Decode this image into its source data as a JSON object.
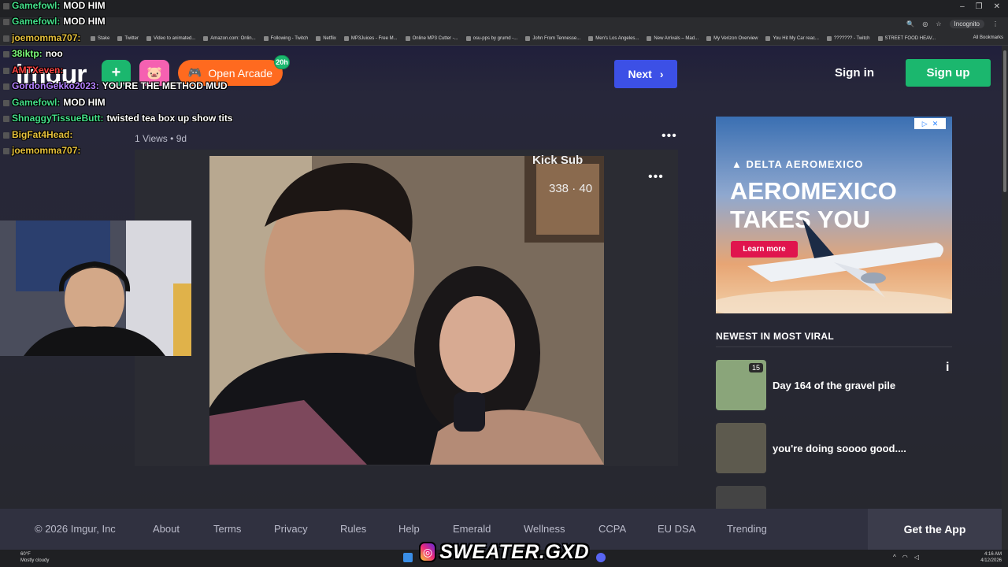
{
  "browser": {
    "window_controls": [
      "–",
      "❐",
      "✕"
    ],
    "incognito_label": "Incognito",
    "all_bookmarks": "All Bookmarks",
    "bookmarks": [
      "Stake",
      "Twitter",
      "Video to animated...",
      "Amazon.com: Onlin...",
      "Following - Twitch",
      "Netflix",
      "MP3Juices - Free M...",
      "Online MP3 Cutter -...",
      "osu-pps by grumd -...",
      "John From Tennesse...",
      "Men's Los Angeles...",
      "New Arrivals – Mad...",
      "My Verizon Overview",
      "You Hit My Car reac...",
      "??????? - Twitch",
      "STREET FOOD HEAV..."
    ]
  },
  "header": {
    "logo": "imgur",
    "new_post_icon": "+",
    "arcade_label": "Open Arcade",
    "arcade_badge": "20h",
    "next_label": "Next",
    "sign_in": "Sign in",
    "sign_up": "Sign up"
  },
  "post": {
    "views": "1 Views",
    "separator": "•",
    "age": "9d",
    "more": "•••",
    "overlay_title": "Kick Sub",
    "overlay_count": "338 · 40"
  },
  "ad": {
    "brand_line": "▲ DELTA   AEROMEXICO",
    "headline": "AEROMEXICO TAKES YOU",
    "cta": "Learn more"
  },
  "sidebar": {
    "section_title": "NEWEST IN MOST VIRAL",
    "items": [
      {
        "title": "Day 164 of the gravel pile",
        "count": "15",
        "thumb_color": "#8aa57a"
      },
      {
        "title": "you're doing soooo good....",
        "count": "",
        "thumb_color": "#5d5a4e"
      },
      {
        "title": "",
        "count": "",
        "thumb_color": "#444"
      }
    ]
  },
  "footer": {
    "copyright": "© 2026 Imgur, Inc",
    "links": [
      "About",
      "Terms",
      "Privacy",
      "Rules",
      "Help",
      "Emerald",
      "Wellness",
      "CCPA",
      "EU DSA",
      "Trending"
    ],
    "get_app": "Get the App"
  },
  "taskbar": {
    "temp": "60°F",
    "weather": "Mostly cloudy",
    "time": "4:16 AM",
    "date": "4/12/2026"
  },
  "chat": [
    {
      "user": "Gamefowl:",
      "msg": "MOD HIM",
      "color": "#44e08a"
    },
    {
      "user": "Gamefowl:",
      "msg": "MOD HIM",
      "color": "#44e08a"
    },
    {
      "user": "joemomma707:",
      "msg": "",
      "color": "#e6c13c"
    },
    {
      "user": "38iktp:",
      "msg": "noo",
      "color": "#7cfc7c"
    },
    {
      "user": "AMTXeven:",
      "msg": "",
      "color": "#ff4444"
    },
    {
      "user": "GordonGekko2023:",
      "msg": "YOU'RE THE METHOD MUD",
      "color": "#b380ff"
    },
    {
      "user": "Gamefowl:",
      "msg": "MOD HIM",
      "color": "#44e08a"
    },
    {
      "user": "ShnaggyTissueButt:",
      "msg": "twisted tea box up show tits",
      "color": "#44e08a"
    },
    {
      "user": "BigFat4Head:",
      "msg": "",
      "color": "#e6c13c"
    },
    {
      "user": "joemomma707:",
      "msg": "",
      "color": "#e6c13c"
    }
  ],
  "watermark": "SWEATER.GXD"
}
